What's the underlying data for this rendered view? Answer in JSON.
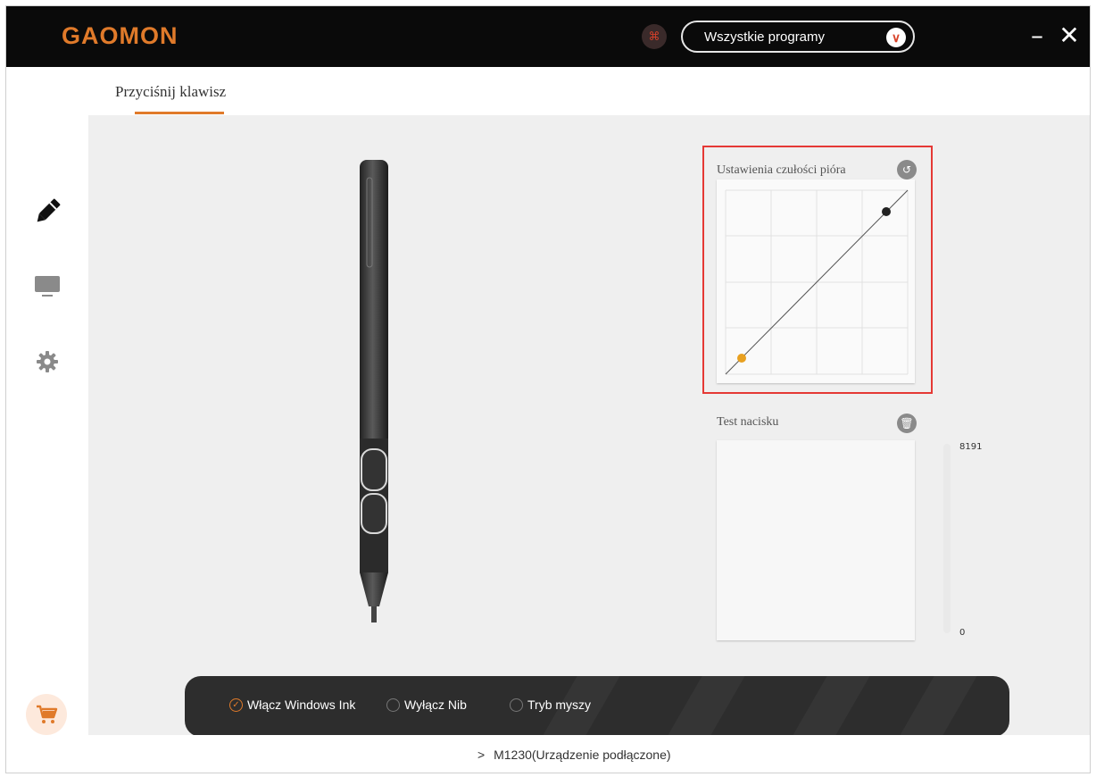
{
  "header": {
    "logo": "GAOMON",
    "program_select": {
      "value": "Wszystkie programy"
    },
    "minimize": "–",
    "close": "✕"
  },
  "tabs": [
    {
      "label": "Przyciśnij klawisz",
      "active": true
    }
  ],
  "sidebar": {
    "items": [
      {
        "icon": "pen-icon"
      },
      {
        "icon": "monitor-icon"
      },
      {
        "icon": "gear-icon"
      }
    ],
    "cart_icon": "cart-icon"
  },
  "sensitivity": {
    "title": "Ustawienia czułości pióra",
    "reset_icon": "reset-icon"
  },
  "pressure_test": {
    "title": "Test nacisku",
    "clear_icon": "trash-icon",
    "max": "8191",
    "min": "0"
  },
  "options": [
    {
      "label": "Włącz Windows Ink",
      "checked": true
    },
    {
      "label": "Wyłącz Nib",
      "checked": false
    },
    {
      "label": "Tryb myszy",
      "checked": false
    }
  ],
  "status": {
    "arrow": ">",
    "device": "M1230(Urządzenie podłączone)"
  },
  "colors": {
    "accent": "#e07a2a",
    "highlight": "#e53935",
    "titlebar": "#0a0a0a"
  }
}
